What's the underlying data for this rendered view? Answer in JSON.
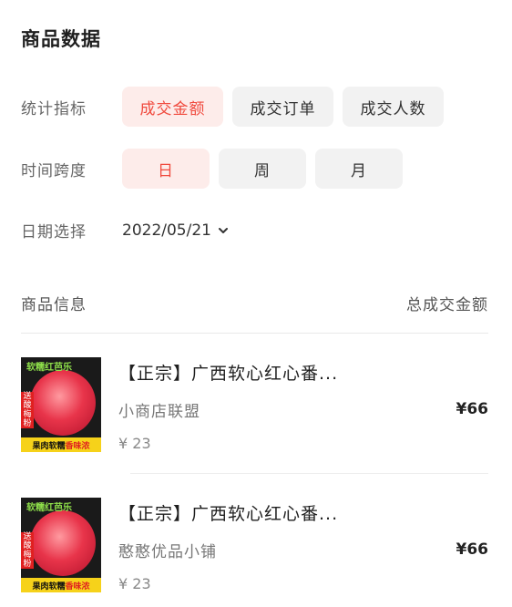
{
  "page": {
    "title": "商品数据"
  },
  "filters": {
    "metric": {
      "label": "统计指标",
      "options": [
        "成交金额",
        "成交订单",
        "成交人数"
      ],
      "selected": "成交金额"
    },
    "span": {
      "label": "时间跨度",
      "options": [
        "日",
        "周",
        "月"
      ],
      "selected": "日"
    },
    "date": {
      "label": "日期选择",
      "value": "2022/05/21",
      "icon": "chevron-down-icon"
    }
  },
  "table": {
    "col_product": "商品信息",
    "col_amount": "总成交金额"
  },
  "products": [
    {
      "title": "【正宗】广西软心红心番...",
      "shop": "小商店联盟",
      "price": "¥ 23",
      "amount": "¥66",
      "thumb": {
        "top_text": "软糯红芭乐",
        "side_text": "送酸梅粉",
        "bottom_text_a": "果肉软糯",
        "bottom_text_b": "香味浓"
      }
    },
    {
      "title": "【正宗】广西软心红心番...",
      "shop": "憨憨优品小铺",
      "price": "¥ 23",
      "amount": "¥66",
      "thumb": {
        "top_text": "软糯红芭乐",
        "side_text": "送酸梅粉",
        "bottom_text_a": "果肉软糯",
        "bottom_text_b": "香味浓"
      }
    }
  ],
  "colors": {
    "accent": "#f04a3e",
    "accent_bg": "#fdecea",
    "chip_bg": "#f2f2f2"
  }
}
